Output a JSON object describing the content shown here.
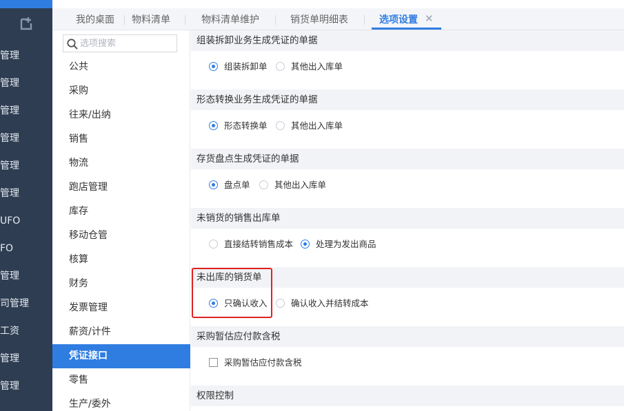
{
  "leftnav": {
    "accent_color": "#2f7de1",
    "background_color": "#2e3d52",
    "logo_icon": "app-logo-icon",
    "items": [
      "管理",
      "管理",
      "管理",
      "管理",
      "管理",
      "管理",
      "UFO",
      "FO",
      "管理",
      "司管理",
      "工资",
      "管理",
      "管理"
    ]
  },
  "tabs": [
    {
      "label": "我的桌面",
      "active": false
    },
    {
      "label": "物料清单",
      "active": false
    },
    {
      "label": "物料清单维护",
      "active": false
    },
    {
      "label": "销货单明细表",
      "active": false
    },
    {
      "label": "选项设置",
      "active": true
    }
  ],
  "tab_close_icon": "close-icon",
  "search": {
    "placeholder": "选项搜索",
    "value": "",
    "icon": "search-icon"
  },
  "sidebar": {
    "items": [
      {
        "label": "公共",
        "active": false
      },
      {
        "label": "采购",
        "active": false
      },
      {
        "label": "往来/出纳",
        "active": false
      },
      {
        "label": "销售",
        "active": false
      },
      {
        "label": "物流",
        "active": false
      },
      {
        "label": "跑店管理",
        "active": false
      },
      {
        "label": "库存",
        "active": false
      },
      {
        "label": "移动仓管",
        "active": false
      },
      {
        "label": "核算",
        "active": false
      },
      {
        "label": "财务",
        "active": false
      },
      {
        "label": "发票管理",
        "active": false
      },
      {
        "label": "薪资/计件",
        "active": false
      },
      {
        "label": "凭证接口",
        "active": true
      },
      {
        "label": "零售",
        "active": false
      },
      {
        "label": "生产/委外",
        "active": false
      }
    ]
  },
  "sections": [
    {
      "title": "组装拆卸业务生成凭证的单据",
      "type": "radio",
      "options": [
        {
          "label": "组装拆卸单",
          "checked": true
        },
        {
          "label": "其他出入库单",
          "checked": false
        }
      ]
    },
    {
      "title": "形态转换业务生成凭证的单据",
      "type": "radio",
      "options": [
        {
          "label": "形态转换单",
          "checked": true
        },
        {
          "label": "其他出入库单",
          "checked": false
        }
      ]
    },
    {
      "title": "存货盘点生成凭证的单据",
      "type": "radio",
      "options": [
        {
          "label": "盘点单",
          "checked": true
        },
        {
          "label": "其他出入库单",
          "checked": false
        }
      ]
    },
    {
      "title": "未销货的销售出库单",
      "type": "radio",
      "options": [
        {
          "label": "直接结转销售成本",
          "checked": false
        },
        {
          "label": "处理为发出商品",
          "checked": true
        }
      ]
    },
    {
      "title": "未出库的销货单",
      "type": "radio",
      "highlighted": true,
      "options": [
        {
          "label": "只确认收入",
          "checked": true
        },
        {
          "label": "确认收入并结转成本",
          "checked": false
        }
      ]
    },
    {
      "title": "采购暂估应付款含税",
      "type": "checkbox",
      "options": [
        {
          "label": "采购暂估应付款含税",
          "checked": false
        }
      ]
    },
    {
      "title": "权限控制",
      "type": "none",
      "options": []
    }
  ],
  "colors": {
    "accent": "#2f7de1",
    "highlight_border": "#e02020",
    "section_header_bg": "#f1f3f6"
  }
}
